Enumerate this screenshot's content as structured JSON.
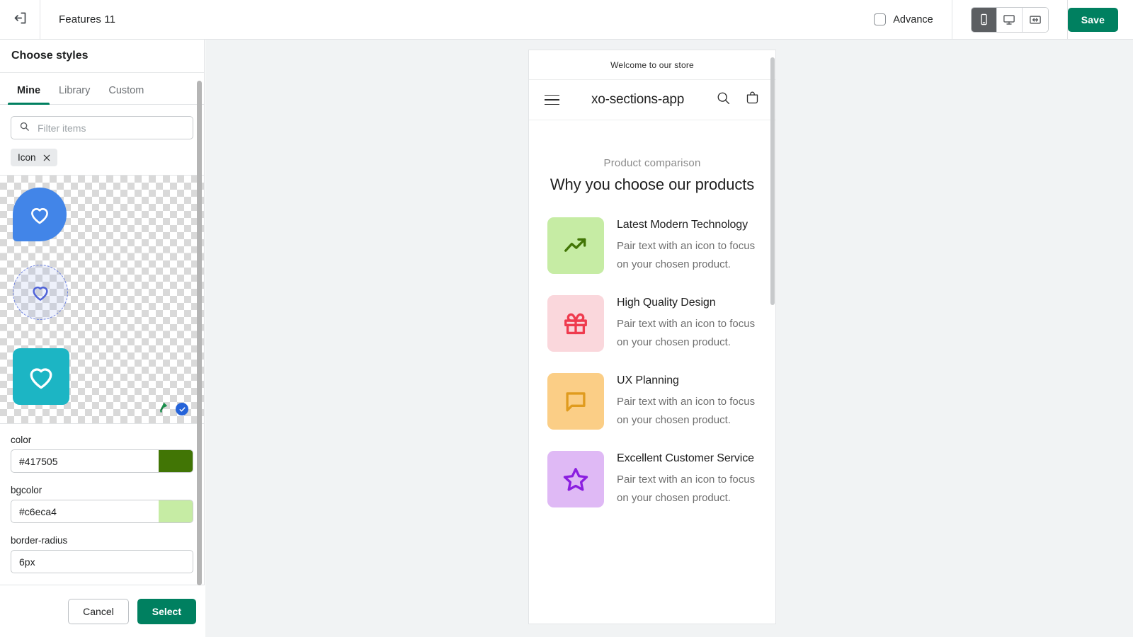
{
  "topbar": {
    "back_icon": "exit-left-icon",
    "title": "Features 11",
    "advance_label": "Advance",
    "advance_checked": false,
    "devices": [
      {
        "name": "mobile",
        "icon": "mobile-icon",
        "active": true
      },
      {
        "name": "desktop",
        "icon": "desktop-icon",
        "active": false
      },
      {
        "name": "fullwidth",
        "icon": "fullwidth-icon",
        "active": false
      }
    ],
    "save_label": "Save",
    "save_color": "#008060"
  },
  "panel": {
    "header": "Choose styles",
    "tabs": [
      {
        "label": "Mine",
        "active": true
      },
      {
        "label": "Library",
        "active": false
      },
      {
        "label": "Custom",
        "active": false
      }
    ],
    "active_tab_color": "#008060",
    "search": {
      "placeholder": "Filter items",
      "value": "",
      "icon": "search-icon"
    },
    "chips": [
      {
        "label": "Icon",
        "remove_icon": "close-icon"
      }
    ],
    "thumbnails": [
      {
        "name": "blue-pin-heart",
        "shape": "teardrop",
        "color": "#4285e8",
        "glyph": "heart-icon",
        "selected": false
      },
      {
        "name": "dashed-circle-heart",
        "shape": "dashed-circle",
        "color": "#6a7fe0",
        "glyph": "heart-icon",
        "selected": false
      },
      {
        "name": "teal-square-heart",
        "shape": "rounded-square",
        "color": "#1cb5c4",
        "glyph": "heart-icon",
        "selected": true
      }
    ],
    "thumb_badges": {
      "brush_icon": "paint-roller-icon",
      "check_icon": "check-circle-icon",
      "check_color": "#2563d9"
    },
    "fields": [
      {
        "label": "color",
        "value": "#417505",
        "swatch": "#417505"
      },
      {
        "label": "bgcolor",
        "value": "#c6eca4",
        "swatch": "#c6eca4"
      },
      {
        "label": "border-radius",
        "value": "6px",
        "swatch": null
      }
    ],
    "footer": {
      "cancel_label": "Cancel",
      "select_label": "Select"
    }
  },
  "preview": {
    "announcement": "Welcome to our store",
    "store_name": "xo-sections-app",
    "menu_icon": "hamburger-icon",
    "search_icon": "search-icon",
    "cart_icon": "shopping-bag-icon",
    "eyebrow": "Product comparison",
    "title": "Why you choose our products",
    "features": [
      {
        "title": "Latest Modern Technology",
        "description": "Pair text with an icon to focus on your chosen product.",
        "icon": "trending-up-icon",
        "icon_color": "#417505",
        "bg_color": "#c6eca4"
      },
      {
        "title": "High Quality Design",
        "description": "Pair text with an icon to focus on your chosen product.",
        "icon": "gift-icon",
        "icon_color": "#ef3b4e",
        "bg_color": "#fad7dc"
      },
      {
        "title": "UX Planning",
        "description": "Pair text with an icon to focus on your chosen product.",
        "icon": "chat-bubble-icon",
        "icon_color": "#e09b1e",
        "bg_color": "#fbce86"
      },
      {
        "title": "Excellent Customer Service",
        "description": "Pair text with an icon to focus on your chosen product.",
        "icon": "star-icon",
        "icon_color": "#8b1ee0",
        "bg_color": "#dfb9f5"
      }
    ]
  }
}
